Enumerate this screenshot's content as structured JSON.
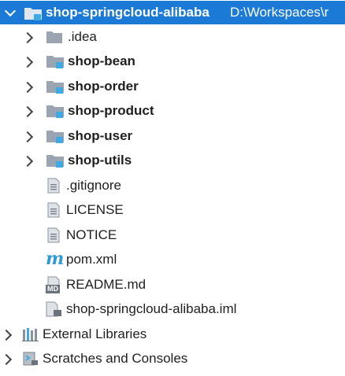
{
  "root": {
    "name": "shop-springcloud-alibaba",
    "path": "D:\\Workspaces\\r"
  },
  "children": [
    {
      "label": ".idea",
      "type": "folder"
    },
    {
      "label": "shop-bean",
      "type": "module"
    },
    {
      "label": "shop-order",
      "type": "module"
    },
    {
      "label": "shop-product",
      "type": "module"
    },
    {
      "label": "shop-user",
      "type": "module"
    },
    {
      "label": "shop-utils",
      "type": "module"
    },
    {
      "label": ".gitignore",
      "type": "file"
    },
    {
      "label": "LICENSE",
      "type": "file"
    },
    {
      "label": "NOTICE",
      "type": "file"
    },
    {
      "label": "pom.xml",
      "type": "maven"
    },
    {
      "label": "README.md",
      "type": "markdown"
    },
    {
      "label": "shop-springcloud-alibaba.iml",
      "type": "iml"
    }
  ],
  "bottom": {
    "external_libraries": "External Libraries",
    "scratches": "Scratches and Consoles"
  },
  "icons": {
    "md_badge": "MD",
    "maven_glyph": "m"
  },
  "colors": {
    "selection": "#1a7ad6",
    "folder": "#9aa5b1",
    "module_badge": "#3fa9e6"
  }
}
